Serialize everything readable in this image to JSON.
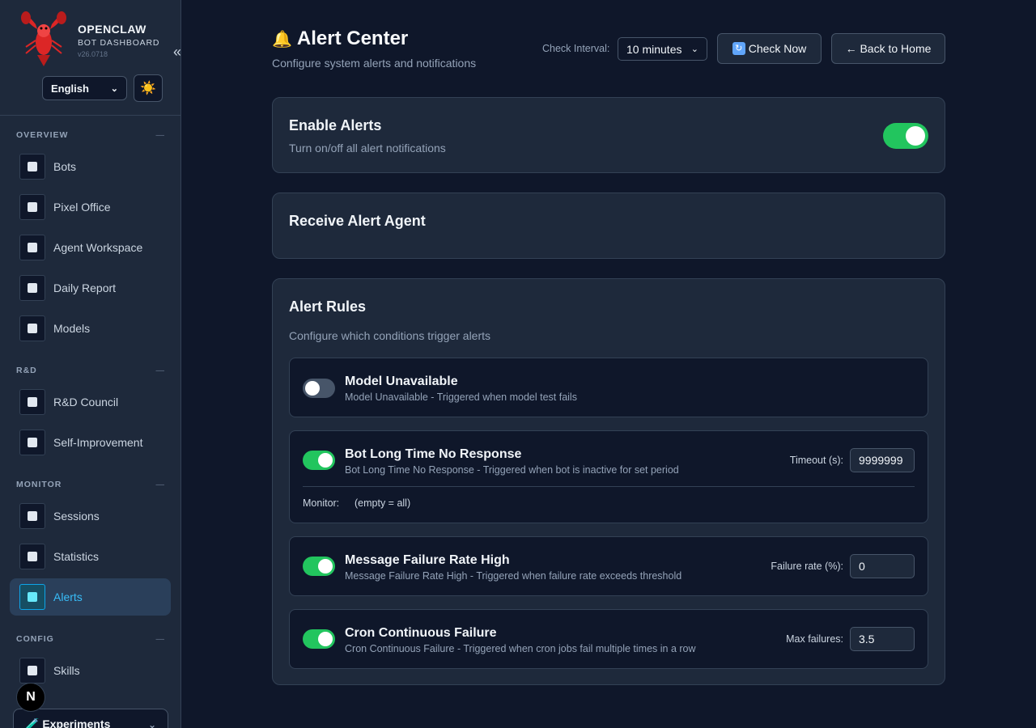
{
  "sidebar": {
    "brand_name": "OPENCLAW",
    "brand_sub": "BOT DASHBOARD",
    "version": "v26.0718",
    "collapse_glyph": "«",
    "language": "English",
    "theme_icon": "☀️",
    "sections": [
      {
        "title": "OVERVIEW",
        "items": [
          {
            "label": "Bots",
            "icon": "robot-icon"
          },
          {
            "label": "Pixel Office",
            "icon": "office-icon"
          },
          {
            "label": "Agent Workspace",
            "icon": "workspace-icon"
          },
          {
            "label": "Daily Report",
            "icon": "report-icon"
          },
          {
            "label": "Models",
            "icon": "model-icon"
          }
        ]
      },
      {
        "title": "R&D",
        "items": [
          {
            "label": "R&D Council",
            "icon": "council-icon"
          },
          {
            "label": "Self-Improvement",
            "icon": "improvement-icon"
          }
        ]
      },
      {
        "title": "MONITOR",
        "items": [
          {
            "label": "Sessions",
            "icon": "sessions-icon"
          },
          {
            "label": "Statistics",
            "icon": "statistics-icon"
          },
          {
            "label": "Alerts",
            "icon": "alerts-icon",
            "active": true
          }
        ]
      },
      {
        "title": "CONFIG",
        "items": [
          {
            "label": "Skills",
            "icon": "skills-icon"
          }
        ]
      }
    ],
    "experiments_label": "🧪 Experiments",
    "next_badge": "N"
  },
  "header": {
    "title": "Alert Center",
    "title_icon": "🔔",
    "subtitle": "Configure system alerts and notifications",
    "interval_label": "Check Interval:",
    "interval_value": "10 minutes",
    "check_now": "Check Now",
    "back_home": "← Back to Home"
  },
  "enable_card": {
    "title": "Enable Alerts",
    "desc": "Turn on/off all alert notifications",
    "enabled": true
  },
  "agent_card": {
    "title": "Receive Alert Agent"
  },
  "rules_card": {
    "title": "Alert Rules",
    "desc": "Configure which conditions trigger alerts",
    "rules": [
      {
        "title": "Model Unavailable",
        "desc": "Model Unavailable - Triggered when model test fails",
        "enabled": false
      },
      {
        "title": "Bot Long Time No Response",
        "desc": "Bot Long Time No Response - Triggered when bot is inactive for set period",
        "enabled": true,
        "param_label": "Timeout (s):",
        "param_value": "9999999",
        "monitor_label": "Monitor:",
        "monitor_value": "(empty = all)"
      },
      {
        "title": "Message Failure Rate High",
        "desc": "Message Failure Rate High - Triggered when failure rate exceeds threshold",
        "enabled": true,
        "param_label": "Failure rate (%):",
        "param_value": "0"
      },
      {
        "title": "Cron Continuous Failure",
        "desc": "Cron Continuous Failure - Triggered when cron jobs fail multiple times in a row",
        "enabled": true,
        "param_label": "Max failures:",
        "param_value": "3.5"
      }
    ]
  },
  "colors": {
    "background": "#0f172a",
    "card": "#1e293b",
    "accent": "#38bdf8",
    "toggle_on": "#22c55e"
  }
}
